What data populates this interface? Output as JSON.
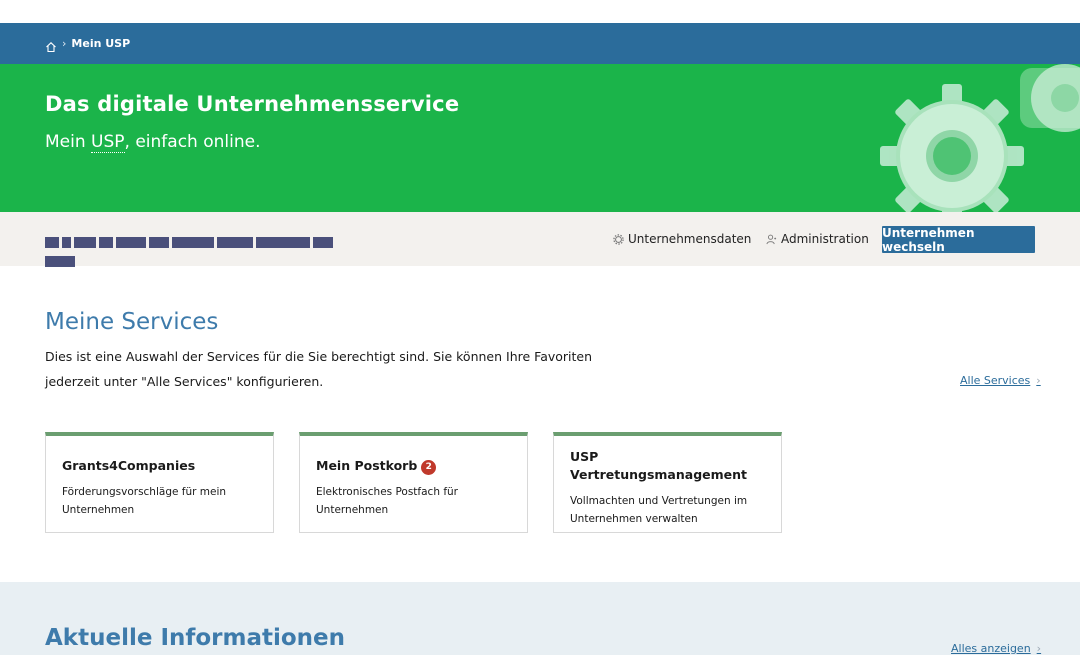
{
  "breadcrumb": {
    "current": "Mein USP"
  },
  "hero": {
    "title": "Das digitale Unternehmensservice",
    "subtitle_prefix": "Mein ",
    "subtitle_abbr": "USP",
    "subtitle_suffix": ", einfach online."
  },
  "company_bar": {
    "links": [
      {
        "label": "Unternehmensdaten",
        "icon": "gear-icon"
      },
      {
        "label": "Administration",
        "icon": "user-icon"
      }
    ],
    "switch_button": "Unternehmen wechseln"
  },
  "services": {
    "title": "Meine Services",
    "intro_line1": "Dies ist eine Auswahl der Services für die Sie berechtigt sind. Sie können Ihre Favoriten",
    "intro_line2": "jederzeit unter \"Alle Services\" konfigurieren.",
    "all_link": "Alle Services",
    "cards": [
      {
        "title": "Grants4Companies",
        "desc_line1": "Förderungsvorschläge für mein",
        "desc_line2": "Unternehmen"
      },
      {
        "title": "Mein Postkorb",
        "badge": "2",
        "desc_line1": "Elektronisches Postfach für",
        "desc_line2": "Unternehmen"
      },
      {
        "title_line1": "USP",
        "title_line2": "Vertretungsmanagement",
        "desc_line1": "Vollmachten und Vertretungen im",
        "desc_line2": "Unternehmen verwalten"
      }
    ]
  },
  "info": {
    "title": "Aktuelle Informationen",
    "show_all": "Alles anzeigen"
  },
  "colors": {
    "brand_blue": "#2b6c9b",
    "hero_green": "#1bb44a",
    "heading_blue": "#3e7bab",
    "badge_red": "#c0392b"
  }
}
